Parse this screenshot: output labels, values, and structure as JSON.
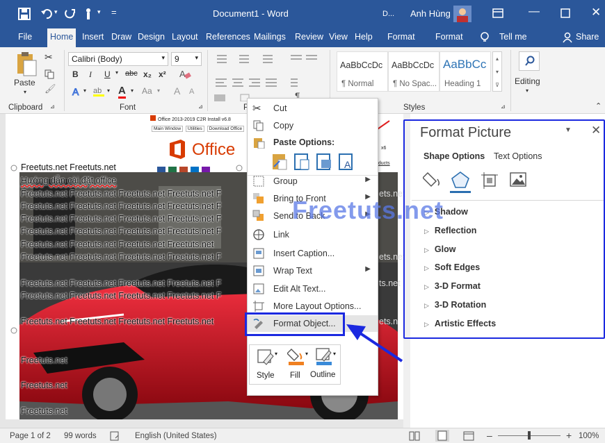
{
  "title": {
    "document": "Document1 - Word",
    "d_label": "D...",
    "user": "Anh Hùng"
  },
  "tabs": [
    "File",
    "Home",
    "Insert",
    "Draw",
    "Design",
    "Layout",
    "References",
    "Mailings",
    "Review",
    "View",
    "Help",
    "Format",
    "Format",
    "Tell me",
    "Share"
  ],
  "ribbon": {
    "clipboard": {
      "paste": "Paste",
      "label": "Clipboard"
    },
    "font": {
      "name": "Calibri (Body)",
      "size": "9",
      "bold": "B",
      "italic": "I",
      "underline": "U",
      "strike": "abc",
      "sub": "x₂",
      "sup": "x²",
      "font_color": "A",
      "change_case": "Aa",
      "grow": "A",
      "shrink": "A",
      "label": "Font"
    },
    "paragraph": {
      "label": "P",
      "pilcrow": "¶"
    },
    "styles": {
      "items": [
        {
          "preview": "AaBbCcDc",
          "name": "¶ Normal"
        },
        {
          "preview": "AaBbCcDc",
          "name": "¶ No Spac..."
        },
        {
          "preview": "AaBbCc",
          "name": "Heading 1"
        }
      ],
      "label": "Styles"
    },
    "editing": {
      "label": "Editing"
    }
  },
  "document": {
    "screenshot_texts": {
      "c2r": "Office 2013-2019 C2R Install v6.8",
      "tabs": [
        "Main Window",
        "Utilities",
        "Download Office"
      ],
      "office": "Office",
      "products": "oducts",
      "x6": "x6"
    },
    "lines": [
      "Freetuts.net Freetuts.net",
      "Hướng dẫn cài đặt office",
      "Freetuts.net Freetuts.net Freetuts.net Freetuts.net F",
      "Freetuts.net Freetuts.net Freetuts.net Freetuts.net F",
      "Freetuts.net Freetuts.net Freetuts.net Freetuts.net F",
      "Freetuts.net Freetuts.net Freetuts.net Freetuts.net F",
      "Freetuts.net Freetuts.net Freetuts.net Freetuts.net",
      "Freetuts.net Freetuts.net Freetuts.net Freetuts.net F",
      "Freetuts.net Freetuts.net Freetuts.net Freetuts.net F",
      "Freetuts.net Freetuts.net Freetuts.net Freetuts.net F",
      "Freetuts.net Freetuts.net Freetuts.net Freetuts.net",
      "Freetuts.net",
      "Freetuts.net",
      "Freetuts.net"
    ],
    "right_fragments": [
      "ets.net",
      "ets.net",
      "ts.net",
      "ets.n"
    ]
  },
  "context_menu": {
    "cut": "Cut",
    "copy": "Copy",
    "paste_options": "Paste Options:",
    "items": [
      {
        "label": "Group",
        "sub": true
      },
      {
        "label": "Bring to Front",
        "sub": true
      },
      {
        "label": "Send to Back",
        "sub": true
      },
      {
        "label": "Link",
        "sub": false
      },
      {
        "label": "Insert Caption...",
        "sub": false
      },
      {
        "label": "Wrap Text",
        "sub": true
      },
      {
        "label": "Edit Alt Text...",
        "sub": false
      },
      {
        "label": "More Layout Options...",
        "sub": false
      },
      {
        "label": "Format Object...",
        "sub": false
      }
    ],
    "mini": [
      "Style",
      "Fill",
      "Outline"
    ]
  },
  "pane": {
    "title": "Format Picture",
    "tab_shape": "Shape Options",
    "tab_text": "Text Options",
    "sections": [
      "Shadow",
      "Reflection",
      "Glow",
      "Soft Edges",
      "3-D Format",
      "3-D Rotation",
      "Artistic Effects"
    ]
  },
  "watermark": "Freetuts.net",
  "status": {
    "page": "Page 1 of 2",
    "words": "99 words",
    "language": "English (United States)",
    "zoom": "100%"
  },
  "colors": {
    "word_blue": "#2b579a",
    "highlight": "#1b29e0",
    "office_red": "#d83b01",
    "car_red": "#c81020"
  }
}
